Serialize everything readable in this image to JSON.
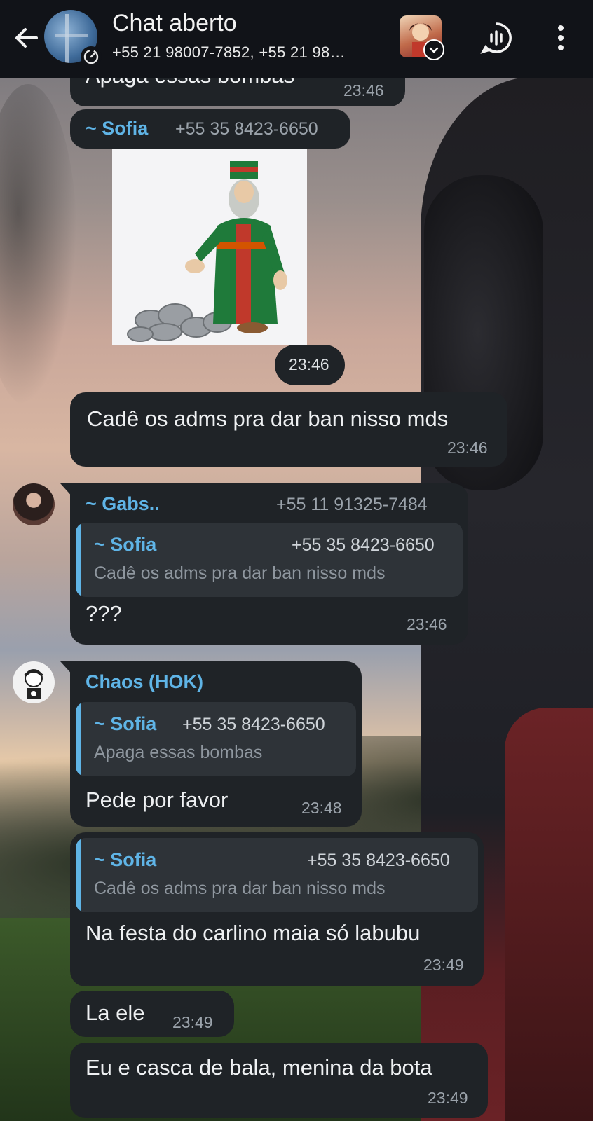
{
  "header": {
    "title": "Chat aberto",
    "subtitle": "+55 21 98007-7852, +55 21 98…"
  },
  "messages": {
    "m0": {
      "text": "Apaga essas bombas",
      "time": "23:46"
    },
    "sofia_sticker": {
      "sender": "~ Sofia",
      "phone": "+55 35 8423-6650",
      "time": "23:46"
    },
    "m2": {
      "text": "Cadê os adms pra dar ban nisso mds",
      "time": "23:46"
    },
    "gabs": {
      "sender": "~ Gabs..",
      "phone": "+55 11 91325-7484",
      "quote_name": "~ Sofia",
      "quote_phone": "+55 35 8423-6650",
      "quote_text": "Cadê os adms pra dar ban nisso mds",
      "text": "???",
      "time": "23:46"
    },
    "chaos1": {
      "sender": "Chaos (HOK)",
      "quote_name": "~ Sofia",
      "quote_phone": "+55 35 8423-6650",
      "quote_text": "Apaga essas bombas",
      "text": "Pede por favor",
      "time": "23:48"
    },
    "chaos2": {
      "quote_name": "~ Sofia",
      "quote_phone": "+55 35 8423-6650",
      "quote_text": "Cadê os adms pra dar ban nisso mds",
      "text": "Na festa do carlino maia só labubu",
      "time": "23:49"
    },
    "chaos3": {
      "text": "La ele",
      "time": "23:49"
    },
    "chaos4": {
      "text": "Eu e casca de bala, menina da bota",
      "time": "23:49"
    }
  },
  "colors": {
    "bubble": "#1f2327",
    "accent": "#5fb4e6",
    "header": "#111318"
  }
}
